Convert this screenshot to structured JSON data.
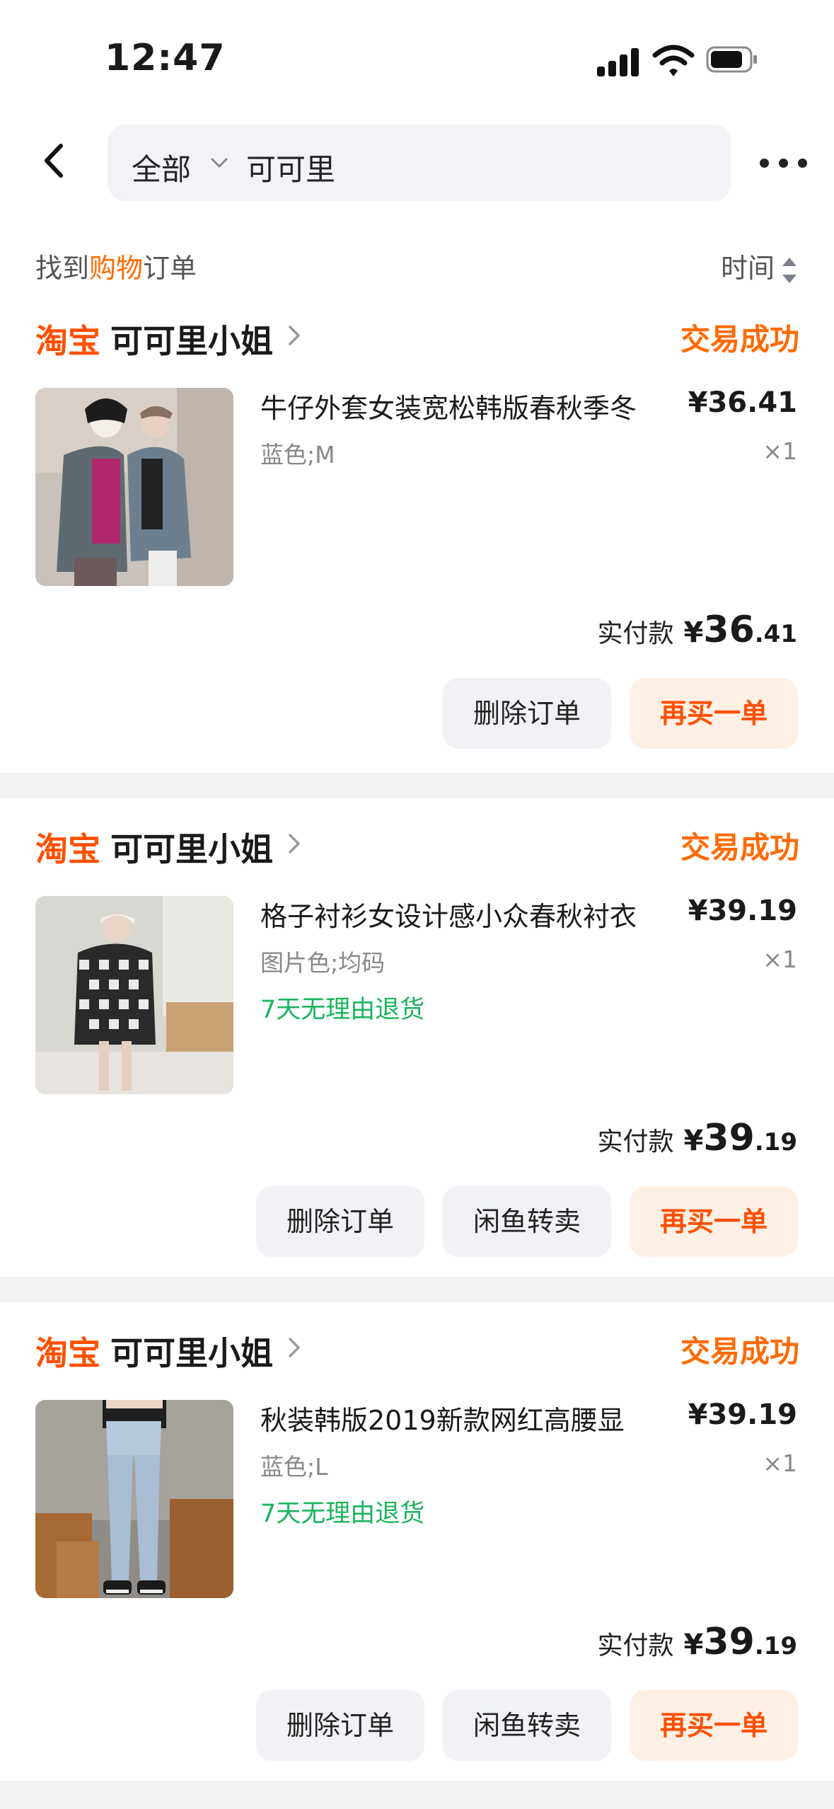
{
  "status_bar": {
    "time": "12:47"
  },
  "header": {
    "scope": "全部",
    "query": "可可里"
  },
  "filter": {
    "found_prefix": "找到",
    "found_highlight": "购物",
    "found_suffix": "订单",
    "sort_label": "时间"
  },
  "colors": {
    "accent": "#ff5000",
    "status": "#ff6a00",
    "green_tag": "#1ab55c"
  },
  "orders": [
    {
      "platform": "淘宝",
      "shop": "可可里小姐",
      "status": "交易成功",
      "title": "牛仔外套女装宽松韩版春秋季冬",
      "price": "¥36.41",
      "sku": "蓝色;M",
      "qty": "×1",
      "tag": "",
      "paid_label": "实付款",
      "paid_currency": "¥",
      "paid_int": "36",
      "paid_dec": ".41",
      "buttons": [
        "删除订单",
        "再买一单"
      ]
    },
    {
      "platform": "淘宝",
      "shop": "可可里小姐",
      "status": "交易成功",
      "title": "格子衬衫女设计感小众春秋衬衣",
      "price": "¥39.19",
      "sku": "图片色;均码",
      "qty": "×1",
      "tag": "7天无理由退货",
      "paid_label": "实付款",
      "paid_currency": "¥",
      "paid_int": "39",
      "paid_dec": ".19",
      "buttons": [
        "删除订单",
        "闲鱼转卖",
        "再买一单"
      ]
    },
    {
      "platform": "淘宝",
      "shop": "可可里小姐",
      "status": "交易成功",
      "title": "秋装韩版2019新款网红高腰显",
      "price": "¥39.19",
      "sku": "蓝色;L",
      "qty": "×1",
      "tag": "7天无理由退货",
      "paid_label": "实付款",
      "paid_currency": "¥",
      "paid_int": "39",
      "paid_dec": ".19",
      "buttons": [
        "删除订单",
        "闲鱼转卖",
        "再买一单"
      ]
    }
  ]
}
